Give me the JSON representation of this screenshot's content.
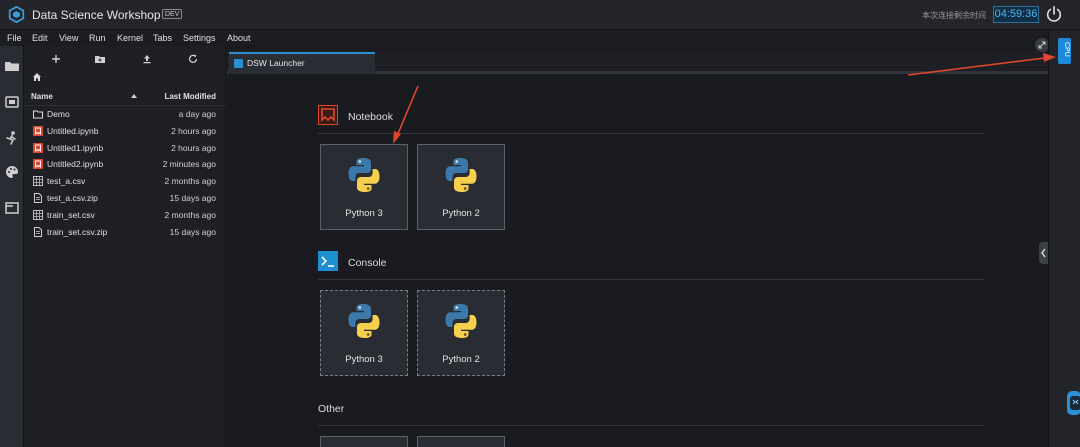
{
  "app": {
    "title": "Data Science Workshop",
    "badge": "DEV",
    "session_label": "本次连接剩余时间",
    "session_time": "04:59:36",
    "accent": "#2a8fd0"
  },
  "menu": [
    "File",
    "Edit",
    "View",
    "Run",
    "Kernel",
    "Tabs",
    "Settings",
    "About"
  ],
  "activity_icons": [
    "folder-icon",
    "running-icon",
    "person-icon",
    "palette-icon",
    "tabs-icon"
  ],
  "file_browser": {
    "toolbar": [
      "new-launcher-icon",
      "new-folder-icon",
      "upload-icon",
      "refresh-icon"
    ],
    "columns": {
      "name": "Name",
      "modified": "Last Modified"
    },
    "files": [
      {
        "name": "Demo",
        "modified": "a day ago",
        "type": "folder"
      },
      {
        "name": "Untitled.ipynb",
        "modified": "2 hours ago",
        "type": "notebook"
      },
      {
        "name": "Untitled1.ipynb",
        "modified": "2 hours ago",
        "type": "notebook"
      },
      {
        "name": "Untitled2.ipynb",
        "modified": "2 minutes ago",
        "type": "notebook"
      },
      {
        "name": "test_a.csv",
        "modified": "2 months ago",
        "type": "csv"
      },
      {
        "name": "test_a.csv.zip",
        "modified": "15 days ago",
        "type": "file"
      },
      {
        "name": "train_set.csv",
        "modified": "2 months ago",
        "type": "csv"
      },
      {
        "name": "train_set.csv.zip",
        "modified": "15 days ago",
        "type": "file"
      }
    ]
  },
  "tabs": [
    {
      "label": "DSW Launcher",
      "active": true
    }
  ],
  "launcher": {
    "notebook": {
      "title": "Notebook",
      "kernels": [
        "Python 3",
        "Python 2"
      ]
    },
    "console": {
      "title": "Console",
      "kernels": [
        "Python 3",
        "Python 2"
      ]
    },
    "other": {
      "title": "Other"
    }
  },
  "right_sidebar": {
    "cpu_label": "CPU"
  },
  "annotation_color": "#e0452e"
}
